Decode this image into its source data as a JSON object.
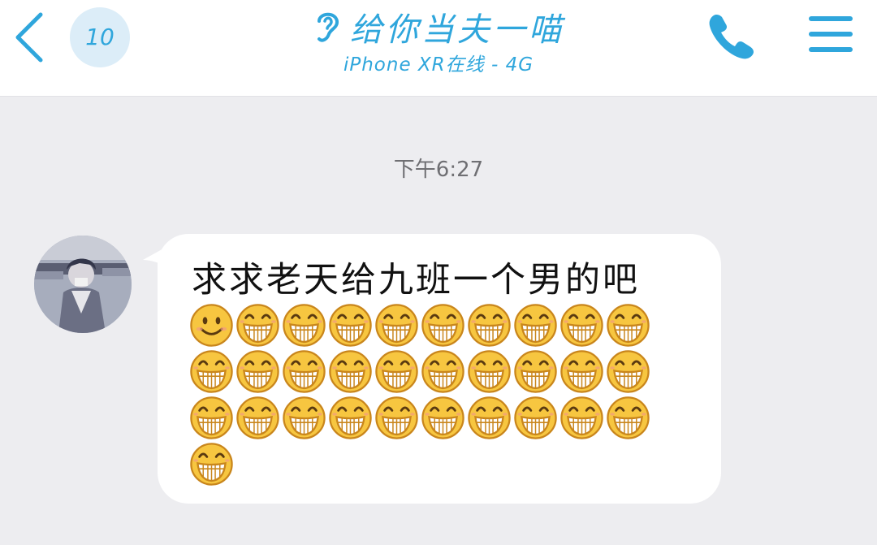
{
  "header": {
    "unread_count": "10",
    "title": "给你当夫一喵",
    "status": "iPhone XR在线 - 4G",
    "icons": {
      "back": "chevron-left-icon",
      "listen": "ear-icon",
      "call": "phone-icon",
      "menu": "hamburger-menu-icon"
    },
    "accent_color": "#2fa6dc"
  },
  "chat": {
    "timestamp": "下午6:27",
    "messages": [
      {
        "sender": "contact",
        "avatar": "anime-avatar",
        "text": "求求老天给九班一个男的吧",
        "emoji": [
          "smile",
          "grin",
          "grin",
          "grin",
          "grin",
          "grin",
          "grin",
          "grin",
          "grin",
          "grin",
          "grin",
          "grin",
          "grin",
          "grin",
          "grin",
          "grin",
          "grin",
          "grin",
          "grin",
          "grin",
          "grin",
          "grin",
          "grin",
          "grin",
          "grin",
          "grin",
          "grin",
          "grin",
          "grin",
          "grin",
          "grin"
        ]
      }
    ]
  },
  "colors": {
    "background": "#ededf0",
    "bubble": "#ffffff",
    "emoji_face": "#f7c640",
    "emoji_outline": "#c9861c"
  }
}
